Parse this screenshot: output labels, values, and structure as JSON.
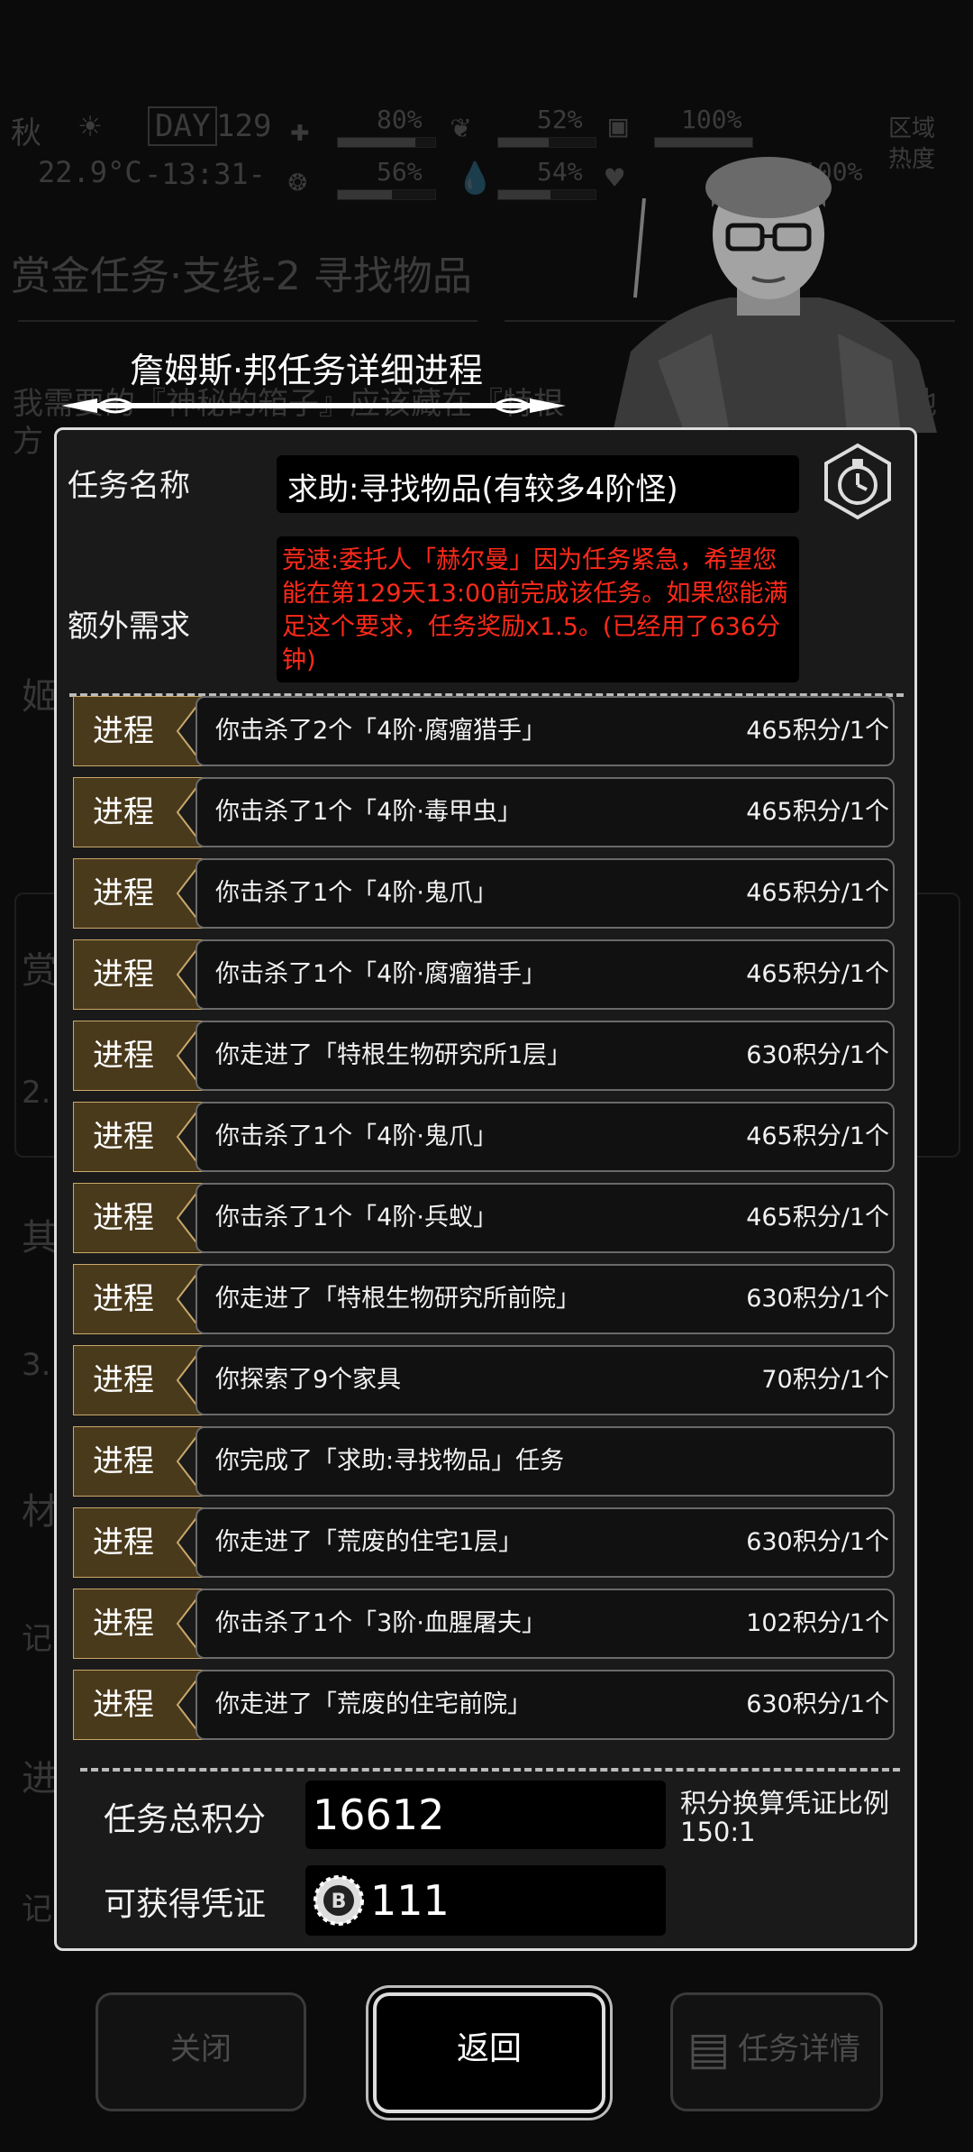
{
  "hud": {
    "season": "秋",
    "day_label": "DAY",
    "day": "129",
    "temperature": "22.9°C",
    "clock": "-13:31-",
    "stat1": "80%",
    "stat2": "56%",
    "stat3": "52%",
    "stat4": "54%",
    "stat5": "100%",
    "stat6": "100%",
    "region_label": "区域",
    "heat_label": "热度"
  },
  "background": {
    "title": "赏金任务·支线-2 寻找物品",
    "text_line1": "我需要的『神秘的箱子』应该藏在『特根",
    "text_line1_end": "个地",
    "text_line2": "方",
    "side_chars": [
      "姬",
      "赏",
      "2.",
      "其",
      "3.",
      "材",
      "记",
      "进",
      "记"
    ]
  },
  "dialog": {
    "heading": "詹姆斯·邦任务详细进程",
    "task_name_label": "任务名称",
    "task_name": "求助:寻找物品(有较多4阶怪)",
    "extra_label": "额外需求",
    "extra_text": "竞速:委托人「赫尔曼」因为任务紧急，希望您能在第129天13:00前完成该任务。如果您能满足这个要求，任务奖励x1.5。(已经用了636分钟)",
    "progress_tag": "进程",
    "rows": [
      {
        "desc": "你击杀了2个「4阶·腐瘤猎手」",
        "points": "465积分/1个"
      },
      {
        "desc": "你击杀了1个「4阶·毒甲虫」",
        "points": "465积分/1个"
      },
      {
        "desc": "你击杀了1个「4阶·鬼爪」",
        "points": "465积分/1个"
      },
      {
        "desc": "你击杀了1个「4阶·腐瘤猎手」",
        "points": "465积分/1个"
      },
      {
        "desc": "你走进了「特根生物研究所1层」",
        "points": "630积分/1个"
      },
      {
        "desc": "你击杀了1个「4阶·鬼爪」",
        "points": "465积分/1个"
      },
      {
        "desc": "你击杀了1个「4阶·兵蚁」",
        "points": "465积分/1个"
      },
      {
        "desc": "你走进了「特根生物研究所前院」",
        "points": "630积分/1个"
      },
      {
        "desc": "你探索了9个家具",
        "points": "70积分/1个"
      },
      {
        "desc": "你完成了「求助:寻找物品」任务",
        "points": ""
      },
      {
        "desc": "你走进了「荒废的住宅1层」",
        "points": "630积分/1个"
      },
      {
        "desc": "你击杀了1个「3阶·血腥屠夫」",
        "points": "102积分/1个"
      },
      {
        "desc": "你走进了「荒废的住宅前院」",
        "points": "630积分/1个"
      }
    ],
    "total_label": "任务总积分",
    "total_value": "16612",
    "ratio_label": "积分换算凭证比例",
    "ratio_value": "150:1",
    "voucher_label": "可获得凭证",
    "voucher_value": "111"
  },
  "buttons": {
    "close": "关闭",
    "back": "返回",
    "details": "任务详情"
  }
}
